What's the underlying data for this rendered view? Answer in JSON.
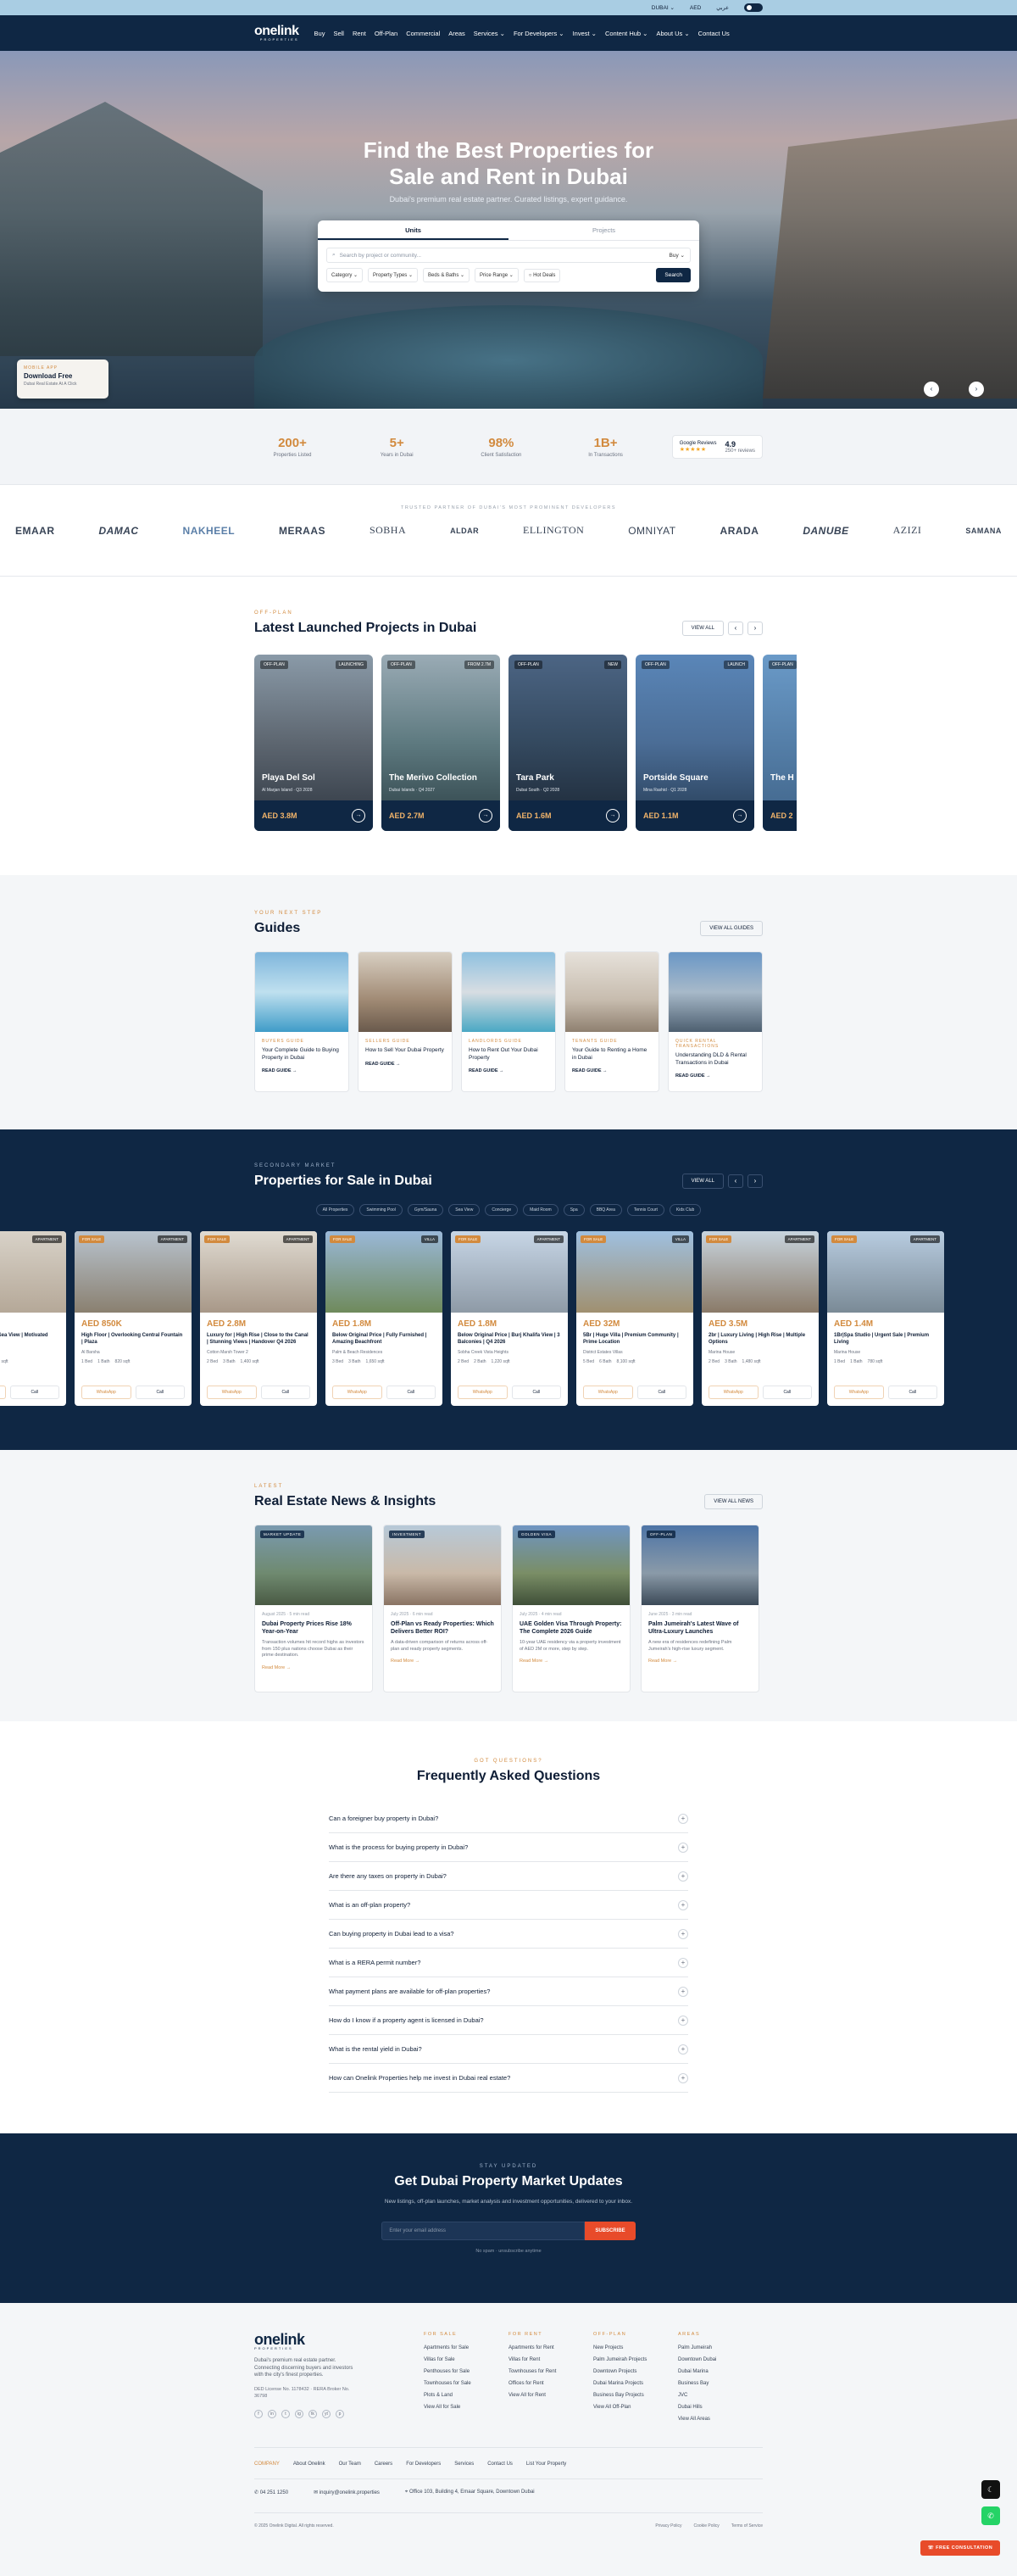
{
  "topbar": {
    "currency": "DUBAI ⌄",
    "lang1": "AED",
    "lang2": "عربي"
  },
  "nav": {
    "logo": "onelink",
    "logo_sub": "PROPERTIES",
    "items": [
      "Buy",
      "Sell",
      "Rent",
      "Off-Plan",
      "Commercial",
      "Areas",
      "Services ⌄",
      "For Developers ⌄",
      "Invest ⌄",
      "Content Hub ⌄",
      "About Us ⌄",
      "Contact Us"
    ]
  },
  "hero": {
    "title_line1": "Find the Best Properties for",
    "title_line2": "Sale and Rent in Dubai",
    "subtitle": "Dubai's premium real estate partner. Curated listings, expert guidance.",
    "tabs": [
      "Units",
      "Projects"
    ],
    "search_placeholder": "Search by project or community...",
    "buy": "Buy ⌄",
    "filters": [
      "Category ⌄",
      "Property Types ⌄",
      "Beds & Baths ⌄",
      "Price Range ⌄",
      "Hot Deals"
    ],
    "search_btn": "Search",
    "app_eyebrow": "MOBILE APP",
    "app_title": "Download Free",
    "app_sub": "Dubai Real Estate At A Click"
  },
  "stats": [
    {
      "value": "200+",
      "label": "Properties Listed"
    },
    {
      "value": "5+",
      "label": "Years in Dubai"
    },
    {
      "value": "98%",
      "label": "Client Satisfaction"
    },
    {
      "value": "1B+",
      "label": "In Transactions"
    }
  ],
  "google": {
    "label": "Google Reviews",
    "stars": "★★★★★",
    "rating": "4.9",
    "count": "250+ reviews"
  },
  "brands": {
    "caption": "TRUSTED PARTNER OF DUBAI'S MOST PROMINENT DEVELOPERS",
    "items": [
      "EMAAR",
      "DAMAC",
      "NAKHEEL",
      "MERAAS",
      "SOBHA",
      "ALDAR",
      "ELLINGTON",
      "OMNIYAT",
      "ARADA",
      "DANUBE",
      "AZIZI",
      "SAMANA"
    ]
  },
  "projects": {
    "eyebrow": "OFF-PLAN",
    "title": "Latest Launched Projects in Dubai",
    "view_all": "VIEW ALL",
    "cards": [
      {
        "tag": "OFF-PLAN",
        "tag2": "LAUNCHING",
        "name": "Playa Del Sol",
        "meta": "Al Marjan Island · Q3 2028",
        "price": "AED 3.8M"
      },
      {
        "tag": "OFF-PLAN",
        "tag2": "FROM 2.7M",
        "name": "The Merivo Collection",
        "meta": "Dubai Islands · Q4 2027",
        "price": "AED 2.7M"
      },
      {
        "tag": "OFF-PLAN",
        "tag2": "NEW",
        "name": "Tara Park",
        "meta": "Dubai South · Q2 2028",
        "price": "AED 1.6M"
      },
      {
        "tag": "OFF-PLAN",
        "tag2": "LAUNCH",
        "name": "Portside Square",
        "meta": "Mina Rashid · Q1 2028",
        "price": "AED 1.1M"
      },
      {
        "tag": "OFF-PLAN",
        "tag2": "",
        "name": "The H",
        "meta": "",
        "price": "AED 2"
      }
    ]
  },
  "guides": {
    "eyebrow": "YOUR NEXT STEP",
    "title": "Guides",
    "view_all": "VIEW ALL GUIDES",
    "read_more": "READ GUIDE →",
    "cards": [
      {
        "cat": "BUYERS GUIDE",
        "title": "Your Complete Guide to Buying Property in Dubai"
      },
      {
        "cat": "SELLERS GUIDE",
        "title": "How to Sell Your Dubai Property"
      },
      {
        "cat": "LANDLORDS GUIDE",
        "title": "How to Rent Out Your Dubai Property"
      },
      {
        "cat": "TENANTS GUIDE",
        "title": "Your Guide to Renting a Home in Dubai"
      },
      {
        "cat": "QUICK RENTAL TRANSACTIONS",
        "title": "Understanding DLD & Rental Transactions in Dubai"
      }
    ]
  },
  "secondary": {
    "eyebrow": "SECONDARY MARKET",
    "title": "Properties for Sale in Dubai",
    "view_all": "VIEW ALL",
    "filters": [
      "All Properties",
      "Swimming Pool",
      "Gym/Sauna",
      "Sea View",
      "Concierge",
      "Maid Room",
      "Spa",
      "BBQ Area",
      "Tennis Court",
      "Kids Club"
    ],
    "whatsapp": "WhatsApp",
    "call": "Call",
    "cards": [
      {
        "badge": "FOR SALE",
        "badge2": "APARTMENT",
        "price": "AED 1.5M",
        "title": "Garden Pool and Sea View | Motivated Seller",
        "loc": "Al Quoz",
        "beds": "2 Bed",
        "baths": "2 Bath",
        "size": "1,150 sqft"
      },
      {
        "badge": "FOR SALE",
        "badge2": "APARTMENT",
        "price": "AED 850K",
        "title": "High Floor | Overlooking Central Fountain | Plaza",
        "loc": "Al Barsha",
        "beds": "1 Bed",
        "baths": "1 Bath",
        "size": "820 sqft"
      },
      {
        "badge": "FOR SALE",
        "badge2": "APARTMENT",
        "price": "AED 2.8M",
        "title": "Luxury for | High Rise | Close to the Canal | Stunning Views | Handover Q4 2026",
        "loc": "Cotton Marsh Tower 2",
        "beds": "2 Bed",
        "baths": "3 Bath",
        "size": "1,400 sqft"
      },
      {
        "badge": "FOR SALE",
        "badge2": "VILLA",
        "price": "AED 1.8M",
        "title": "Below Original Price | Fully Furnished | Amazing Beachfront",
        "loc": "Palm & Beach Residences",
        "beds": "3 Bed",
        "baths": "3 Bath",
        "size": "1,650 sqft"
      },
      {
        "badge": "FOR SALE",
        "badge2": "APARTMENT",
        "price": "AED 1.8M",
        "title": "Below Original Price | Burj Khalifa View | 3 Balconies | Q4 2026",
        "loc": "Sobha Creek Vista Heights",
        "beds": "2 Bed",
        "baths": "2 Bath",
        "size": "1,220 sqft"
      },
      {
        "badge": "FOR SALE",
        "badge2": "VILLA",
        "price": "AED 32M",
        "title": "5Br | Huge Villa | Premium Community | Prime Location",
        "loc": "District Estates Villas",
        "beds": "5 Bed",
        "baths": "6 Bath",
        "size": "8,100 sqft"
      },
      {
        "badge": "FOR SALE",
        "badge2": "APARTMENT",
        "price": "AED 3.5M",
        "title": "2br | Luxury Living | High Rise | Multiple Options",
        "loc": "Marina House",
        "beds": "2 Bed",
        "baths": "3 Bath",
        "size": "1,480 sqft"
      },
      {
        "badge": "FOR SALE",
        "badge2": "APARTMENT",
        "price": "AED 1.4M",
        "title": "1Br|Spa Studio | Urgent Sale | Premium Living",
        "loc": "Marina House",
        "beds": "1 Bed",
        "baths": "1 Bath",
        "size": "780 sqft"
      }
    ]
  },
  "news": {
    "eyebrow": "LATEST",
    "title": "Real Estate News & Insights",
    "view_all": "VIEW ALL NEWS",
    "read_more": "Read More →",
    "cards": [
      {
        "badge": "MARKET UPDATE",
        "date": "August 2025 · 5 min read",
        "title": "Dubai Property Prices Rise 18% Year-on-Year",
        "excerpt": "Transaction volumes hit record highs as investors from 150 plus nations choose Dubai as their prime destination."
      },
      {
        "badge": "INVESTMENT",
        "date": "July 2025 · 6 min read",
        "title": "Off-Plan vs Ready Properties: Which Delivers Better ROI?",
        "excerpt": "A data-driven comparison of returns across off-plan and ready property segments."
      },
      {
        "badge": "GOLDEN VISA",
        "date": "July 2025 · 4 min read",
        "title": "UAE Golden Visa Through Property: The Complete 2026 Guide",
        "excerpt": "10-year UAE residency via a property investment of AED 2M or more, step by step."
      },
      {
        "badge": "OFF-PLAN",
        "date": "June 2025 · 3 min read",
        "title": "Palm Jumeirah's Latest Wave of Ultra-Luxury Launches",
        "excerpt": "A new era of residences redefining Palm Jumeirah's high-rise luxury segment."
      }
    ]
  },
  "faq": {
    "eyebrow": "GOT QUESTIONS?",
    "title": "Frequently Asked Questions",
    "items": [
      "Can a foreigner buy property in Dubai?",
      "What is the process for buying property in Dubai?",
      "Are there any taxes on property in Dubai?",
      "What is an off-plan property?",
      "Can buying property in Dubai lead to a visa?",
      "What is a RERA permit number?",
      "What payment plans are available for off-plan properties?",
      "How do I know if a property agent is licensed in Dubai?",
      "What is the rental yield in Dubai?",
      "How can Onelink Properties help me invest in Dubai real estate?"
    ]
  },
  "newsletter": {
    "eyebrow": "STAY UPDATED",
    "title": "Get Dubai Property Market Updates",
    "desc": "New listings, off-plan launches, market analysis and investment opportunities, delivered to your inbox.",
    "placeholder": "Enter your email address",
    "button": "SUBSCRIBE",
    "privacy": "No spam · unsubscribe anytime"
  },
  "footer": {
    "desc": "Dubai's premium real estate partner. Connecting discerning buyers and investors with the city's finest properties.",
    "license": "DED License No. 1178432 · RERA Broker No. 36798",
    "social": [
      "f",
      "in",
      "t",
      "ig",
      "tk",
      "yt",
      "p"
    ],
    "cols": [
      {
        "head": "FOR SALE",
        "items": [
          "Apartments for Sale",
          "Villas for Sale",
          "Penthouses for Sale",
          "Townhouses for Sale",
          "Plots & Land",
          "View All for Sale"
        ]
      },
      {
        "head": "FOR RENT",
        "items": [
          "Apartments for Rent",
          "Villas for Rent",
          "Townhouses for Rent",
          "Offices for Rent",
          "View All for Rent"
        ]
      },
      {
        "head": "OFF-PLAN",
        "items": [
          "New Projects",
          "Palm Jumeirah Projects",
          "Downtown Projects",
          "Dubai Marina Projects",
          "Business Bay Projects",
          "View All Off-Plan"
        ]
      },
      {
        "head": "AREAS",
        "items": [
          "Palm Jumeirah",
          "Downtown Dubai",
          "Dubai Marina",
          "Business Bay",
          "JVC",
          "Dubai Hills",
          "View All Areas"
        ]
      }
    ],
    "links": [
      "COMPANY",
      "About Onelink",
      "Our Team",
      "Careers",
      "For Developers",
      "Services",
      "Contact Us",
      "List Your Property"
    ],
    "phone": "04 251 1250",
    "email": "inquiry@onelink.properties",
    "address": "Office 103, Building 4, Emaar Square, Downtown Dubai",
    "copyright": "© 2025 Onelink Digital. All rights reserved.",
    "legal": [
      "Privacy Policy",
      "Cookie Policy",
      "Terms of Service"
    ]
  },
  "floats": {
    "consult": "FREE CONSULTATION"
  }
}
